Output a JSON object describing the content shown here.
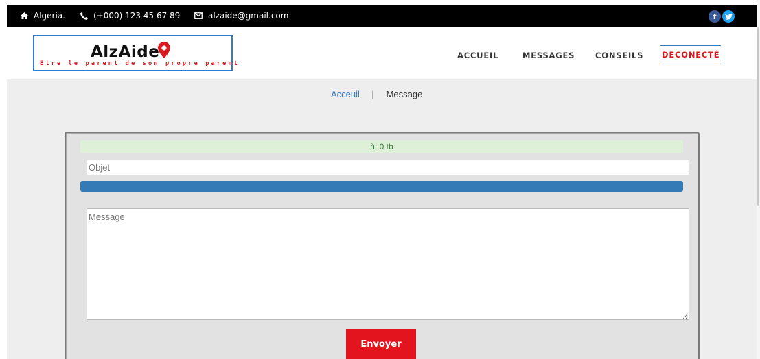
{
  "topbar": {
    "location": "Algeria.",
    "phone": "(+000) 123 45 67 89",
    "email": "alzaide@gmail.com",
    "icons": [
      "home-icon",
      "phone-icon",
      "mail-icon",
      "facebook-icon",
      "twitter-icon"
    ],
    "facebook_label": "f"
  },
  "logo": {
    "name": "AlzAide",
    "tagline": "Etre le parent de son propre parent"
  },
  "nav": {
    "items": [
      {
        "label": "ACCUEIL"
      },
      {
        "label": "MESSAGES"
      },
      {
        "label": "CONSEILS"
      },
      {
        "label": "DECONECTÉ"
      }
    ],
    "active_index": 3
  },
  "breadcrumb": {
    "home": "Acceuil",
    "separator": "|",
    "current": "Message"
  },
  "form": {
    "recipient": "à: 0 tb",
    "subject_placeholder": "Objet",
    "message_placeholder": "Message",
    "submit_label": "Envoyer"
  },
  "colors": {
    "accent_red": "#e3141d",
    "accent_blue": "#2f7bd0",
    "bar_blue": "#337ab7",
    "alert_green_bg": "#dff0d8",
    "facebook": "#3b5998",
    "twitter": "#1da1f2"
  }
}
